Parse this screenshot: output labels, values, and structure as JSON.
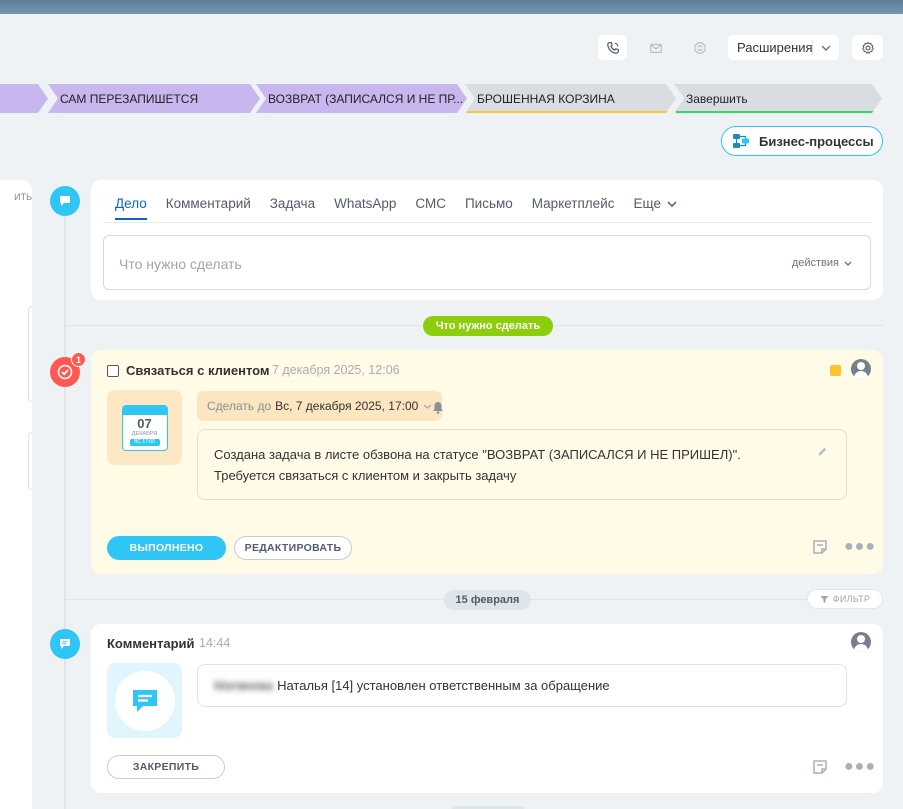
{
  "toolbar": {
    "extensions_label": "Расширения"
  },
  "stages": [
    {
      "label": "",
      "bg": "#c8b7ef",
      "underline": ""
    },
    {
      "label": "САМ ПЕРЕЗАПИШЕТСЯ",
      "bg": "#c8b7ef",
      "underline": ""
    },
    {
      "label": "ВОЗВРАТ (ЗАПИСАЛСЯ И НЕ ПР...",
      "bg": "#c8b7ef",
      "underline": ""
    },
    {
      "label": "БРОШЕННАЯ КОРЗИНА",
      "bg": "#d9dde1",
      "underline": "#ffc43c"
    },
    {
      "label": "Завершить",
      "bg": "#d9dde1",
      "underline": "#2fdd63"
    }
  ],
  "business_processes_label": "Бизнес-процессы",
  "left_edge_text": "ИТЬ",
  "editor": {
    "tabs": [
      "Дело",
      "Комментарий",
      "Задача",
      "WhatsApp",
      "СМС",
      "Письмо",
      "Маркетплейс",
      "Еще"
    ],
    "active_tab": "Дело",
    "placeholder": "Что нужно сделать",
    "actions_label": "действия"
  },
  "timeline": {
    "todo_pill": "Что нужно сделать",
    "date_pill": "15 февраля",
    "filter_label": "ФИЛЬТР"
  },
  "task": {
    "badge_count": "1",
    "title": "Связаться с клиентом",
    "time": "7 декабря 2025, 12:06",
    "calendar": {
      "day": "07",
      "month": "ДЕКАБРЯ",
      "time": "ВС 17:00"
    },
    "deadline_label": "Сделать до",
    "deadline_value": "Вс, 7 декабря 2025, 17:00",
    "description_line1": "Создана задача в листе обзвона на статусе \"ВОЗВРАТ (ЗАПИСАЛСЯ И НЕ ПРИШЕЛ)\".",
    "description_line2": "Требуется связаться с клиентом и закрыть задачу",
    "done_label": "ВЫПОЛНЕНО",
    "edit_label": "РЕДАКТИРОВАТЬ",
    "accent_color": "#ffc32c"
  },
  "comment": {
    "title": "Комментарий",
    "time": "14:44",
    "blurred_name": "Матвеева",
    "text": "Наталья [14] установлен ответственным за обращение",
    "pin_label": "ЗАКРЕПИТЬ"
  },
  "colors": {
    "accent": "#2fc6f6",
    "green_pill": "#8dce0c",
    "alert": "#ff5752"
  }
}
